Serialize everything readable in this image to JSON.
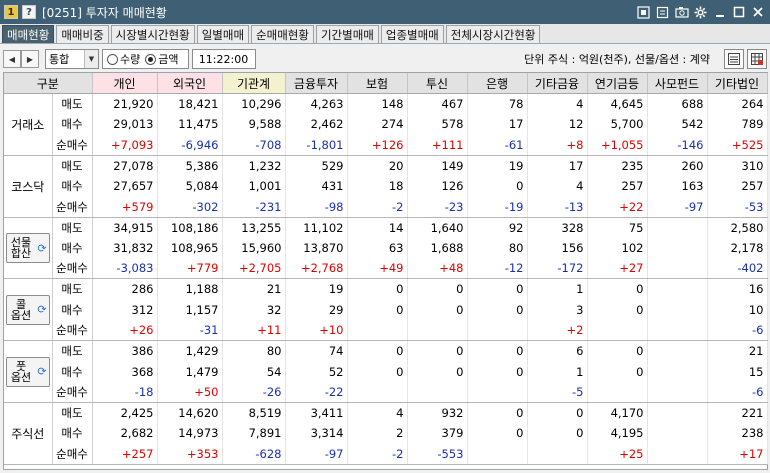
{
  "window": {
    "badge1": "1",
    "badge2": "?",
    "title": "[0251] 투자자 매매현황"
  },
  "tabs": [
    "매매현황",
    "매매비중",
    "시장별시간현황",
    "일별매매",
    "순매매현황",
    "기간별매매",
    "업종별매매",
    "전체시장시간현황"
  ],
  "active_tab": 0,
  "toolbar": {
    "select_value": "통합",
    "radio_qty": "수량",
    "radio_amount": "금액",
    "time": "11:22:00",
    "unit_text": "단위 주식 : 억원(천주), 선물/옵션 : 계약"
  },
  "table": {
    "header_first": "구분",
    "columns": [
      "개인",
      "외국인",
      "기관계",
      "금융투자",
      "보험",
      "투신",
      "은행",
      "기타금융",
      "연기금등",
      "사모펀드",
      "기타법인"
    ],
    "groups": [
      {
        "label": "거래소",
        "button": false,
        "rows": [
          {
            "sub": "매도",
            "vals": [
              "21,920",
              "18,421",
              "10,296",
              "4,263",
              "148",
              "467",
              "78",
              "4",
              "4,645",
              "688",
              "264"
            ]
          },
          {
            "sub": "매수",
            "vals": [
              "29,013",
              "11,475",
              "9,588",
              "2,462",
              "274",
              "578",
              "17",
              "12",
              "5,700",
              "542",
              "789"
            ]
          },
          {
            "sub": "순매수",
            "vals": [
              "+7,093",
              "-6,946",
              "-708",
              "-1,801",
              "+126",
              "+111",
              "-61",
              "+8",
              "+1,055",
              "-146",
              "+525"
            ]
          }
        ]
      },
      {
        "label": "코스닥",
        "button": false,
        "rows": [
          {
            "sub": "매도",
            "vals": [
              "27,078",
              "5,386",
              "1,232",
              "529",
              "20",
              "149",
              "19",
              "17",
              "235",
              "260",
              "310"
            ]
          },
          {
            "sub": "매수",
            "vals": [
              "27,657",
              "5,084",
              "1,001",
              "431",
              "18",
              "126",
              "0",
              "4",
              "257",
              "163",
              "257"
            ]
          },
          {
            "sub": "순매수",
            "vals": [
              "+579",
              "-302",
              "-231",
              "-98",
              "-2",
              "-23",
              "-19",
              "-13",
              "+22",
              "-97",
              "-53"
            ]
          }
        ]
      },
      {
        "label": "선물\n합산",
        "button": true,
        "rows": [
          {
            "sub": "매도",
            "vals": [
              "34,915",
              "108,186",
              "13,255",
              "11,102",
              "14",
              "1,640",
              "92",
              "328",
              "75",
              "",
              "2,580"
            ]
          },
          {
            "sub": "매수",
            "vals": [
              "31,832",
              "108,965",
              "15,960",
              "13,870",
              "63",
              "1,688",
              "80",
              "156",
              "102",
              "",
              "2,178"
            ]
          },
          {
            "sub": "순매수",
            "vals": [
              "-3,083",
              "+779",
              "+2,705",
              "+2,768",
              "+49",
              "+48",
              "-12",
              "-172",
              "+27",
              "",
              "-402"
            ]
          }
        ]
      },
      {
        "label": "콜\n옵션",
        "button": true,
        "rows": [
          {
            "sub": "매도",
            "vals": [
              "286",
              "1,188",
              "21",
              "19",
              "0",
              "0",
              "0",
              "1",
              "0",
              "",
              "16"
            ]
          },
          {
            "sub": "매수",
            "vals": [
              "312",
              "1,157",
              "32",
              "29",
              "0",
              "0",
              "0",
              "3",
              "0",
              "",
              "10"
            ]
          },
          {
            "sub": "순매수",
            "vals": [
              "+26",
              "-31",
              "+11",
              "+10",
              "",
              "",
              "",
              "+2",
              "",
              "",
              "-6"
            ]
          }
        ]
      },
      {
        "label": "풋\n옵션",
        "button": true,
        "rows": [
          {
            "sub": "매도",
            "vals": [
              "386",
              "1,429",
              "80",
              "74",
              "0",
              "0",
              "0",
              "6",
              "0",
              "",
              "21"
            ]
          },
          {
            "sub": "매수",
            "vals": [
              "368",
              "1,479",
              "54",
              "52",
              "0",
              "0",
              "0",
              "1",
              "0",
              "",
              "15"
            ]
          },
          {
            "sub": "순매수",
            "vals": [
              "-18",
              "+50",
              "-26",
              "-22",
              "",
              "",
              "",
              "-5",
              "",
              "",
              "-6"
            ]
          }
        ]
      },
      {
        "label": "주식선",
        "button": false,
        "rows": [
          {
            "sub": "매도",
            "vals": [
              "2,425",
              "14,620",
              "8,519",
              "3,411",
              "4",
              "932",
              "0",
              "0",
              "4,170",
              "",
              "221"
            ]
          },
          {
            "sub": "매수",
            "vals": [
              "2,682",
              "14,973",
              "7,891",
              "3,314",
              "2",
              "379",
              "0",
              "0",
              "4,195",
              "",
              "238"
            ]
          },
          {
            "sub": "순매수",
            "vals": [
              "+257",
              "+353",
              "-628",
              "-97",
              "-2",
              "-553",
              "",
              "",
              "+25",
              "",
              "+17"
            ]
          }
        ]
      }
    ]
  },
  "colors": {
    "positive": "#e00000",
    "negative": "#1a2fb0",
    "titlebar": "#3f5f74",
    "active_tab": "#48606f"
  },
  "icons": {
    "refresh": "refresh-icon"
  }
}
